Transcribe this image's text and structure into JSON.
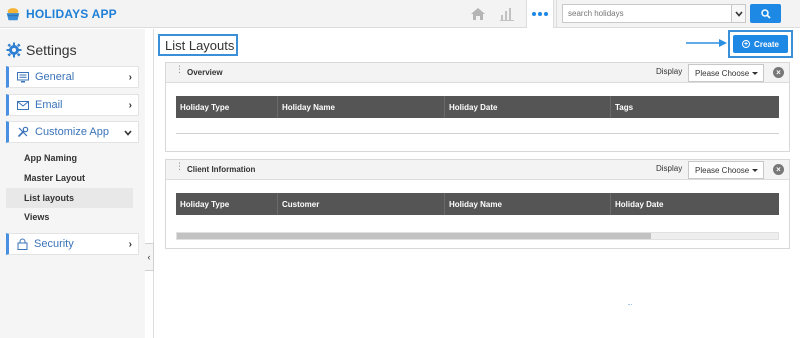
{
  "app": {
    "title": "HOLIDAYS APP"
  },
  "topbar": {
    "search": {
      "placeholder": "search holidays"
    }
  },
  "sidebar": {
    "heading": "Settings",
    "items": [
      {
        "label": "General"
      },
      {
        "label": "Email"
      },
      {
        "label": "Customize App"
      }
    ],
    "subitems": [
      {
        "label": "App Naming"
      },
      {
        "label": "Master Layout"
      },
      {
        "label": "List layouts"
      },
      {
        "label": "Views"
      }
    ],
    "security": {
      "label": "Security"
    },
    "collapse_glyph": "‹"
  },
  "main": {
    "title": "List Layouts",
    "create_label": "Create",
    "panels": [
      {
        "title": "Overview",
        "display_label": "Display",
        "select_value": "Please Choose",
        "columns": [
          "Holiday Type",
          "Holiday Name",
          "Holiday Date",
          "Tags"
        ]
      },
      {
        "title": "Client Information",
        "display_label": "Display",
        "select_value": "Please Choose",
        "columns": [
          "Holiday Type",
          "Customer",
          "Holiday Name",
          "Holiday Date"
        ]
      }
    ]
  },
  "colors": {
    "accent": "#1e88e5",
    "highlight_border": "#3a8fd9",
    "grid_header": "#555555"
  }
}
